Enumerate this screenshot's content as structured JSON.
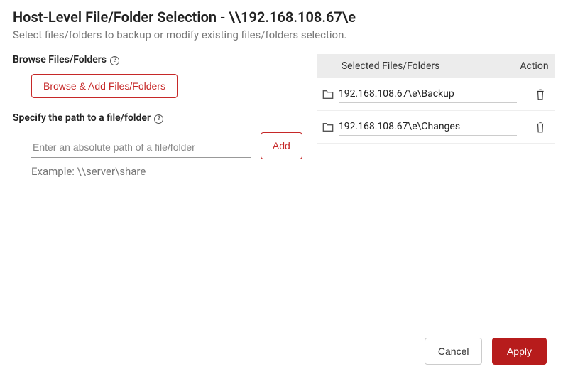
{
  "header": {
    "title": "Host-Level File/Folder Selection - \\\\192.168.108.67\\e",
    "subtitle": "Select files/folders to backup or modify existing files/folders selection."
  },
  "browse": {
    "label": "Browse Files/Folders ",
    "button_label": "Browse & Add Files/Folders"
  },
  "specify": {
    "label": "Specify the path to a file/folder ",
    "placeholder": "Enter an absolute path of a file/folder",
    "add_label": "Add",
    "example": "Example: \\\\server\\share"
  },
  "table": {
    "header_path": "Selected Files/Folders",
    "header_action": "Action",
    "rows": [
      {
        "path": "192.168.108.67\\e\\Backup"
      },
      {
        "path": "192.168.108.67\\e\\Changes"
      }
    ]
  },
  "footer": {
    "cancel": "Cancel",
    "apply": "Apply"
  }
}
